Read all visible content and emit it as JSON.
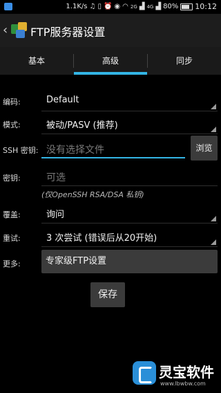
{
  "status": {
    "speed": "1.1K/s",
    "battery": "80%",
    "time": "10:12",
    "net_badge": "2G",
    "signal_badge": "4G"
  },
  "header": {
    "title": "FTP服务器设置"
  },
  "tabs": [
    {
      "label": "基本"
    },
    {
      "label": "高级"
    },
    {
      "label": "同步"
    }
  ],
  "form": {
    "encoding": {
      "label": "编码:",
      "value": "Default"
    },
    "mode": {
      "label": "模式:",
      "value": "被动/PASV (推荐)"
    },
    "ssh_key": {
      "label": "SSH 密钥:",
      "placeholder": "没有选择文件",
      "browse_label": "浏览"
    },
    "key_pass": {
      "label": "密钥:",
      "placeholder": "可选",
      "hint": "(仅OpenSSH RSA/DSA 私钥)"
    },
    "overwrite": {
      "label": "覆盖:",
      "value": "询问"
    },
    "retry": {
      "label": "重试:",
      "value": "3 次尝试 (错误后从20开始)"
    },
    "more": {
      "label": "更多:",
      "button_label": "专家级FTP设置"
    },
    "save_label": "保存"
  },
  "watermark": {
    "name": "灵宝软件",
    "url": "www.lbwbw.com"
  }
}
